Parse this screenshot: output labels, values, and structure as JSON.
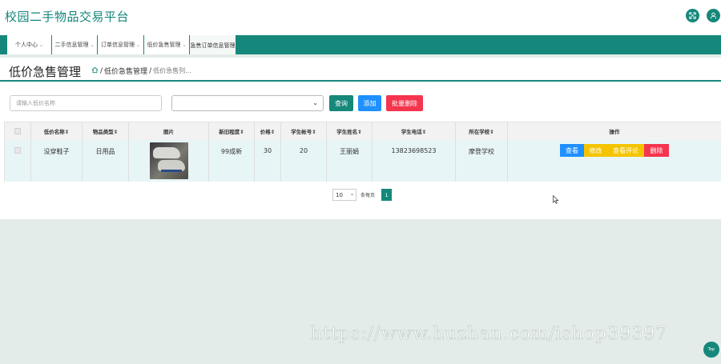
{
  "header": {
    "app_title": "校园二手物品交易平台",
    "icons": [
      "fullscreen-icon",
      "user-icon"
    ]
  },
  "nav": {
    "items": [
      {
        "label": "个人中心",
        "has_caret": true
      },
      {
        "label": "二手信息管理",
        "has_caret": true
      },
      {
        "label": "订单信息管理",
        "has_caret": true
      },
      {
        "label": "低价急售管理",
        "has_caret": true
      },
      {
        "label": "急售订单信息管理",
        "has_caret": false
      }
    ],
    "active_index": 4
  },
  "page": {
    "title": "低价急售管理",
    "breadcrumb": [
      "低价急售管理",
      "低价急售列..."
    ]
  },
  "search": {
    "name_placeholder": "请输入低价名称",
    "select_value": "",
    "query_label": "查询",
    "add_label": "添加",
    "batch_delete_label": "批量删除"
  },
  "table": {
    "columns": [
      "低价名称⇕",
      "物品类型⇕",
      "图片",
      "新旧程度⇕",
      "价格⇕",
      "学生帐号⇕",
      "学生姓名⇕",
      "学生电话⇕",
      "所在学校⇕",
      "操作"
    ],
    "rows": [
      {
        "name": "没穿鞋子",
        "type": "日用品",
        "condition": "99成新",
        "price": "30",
        "account": "20",
        "student_name": "王丽娟",
        "phone": "13823698523",
        "school": "摩登学校"
      }
    ],
    "actions": {
      "view": "查看",
      "edit": "修改",
      "review": "查看评论",
      "delete": "删除"
    }
  },
  "pagination": {
    "page_size": "10",
    "per_page_label": "条每页",
    "current_page": "1"
  },
  "watermark": "https://www.huzhan.com/ishop39397",
  "top_button": "Top",
  "colors": {
    "primary": "#15887b",
    "blue": "#1e90ff",
    "yellow": "#f5c400",
    "red": "#f5344e",
    "background": "#e3ece8"
  }
}
